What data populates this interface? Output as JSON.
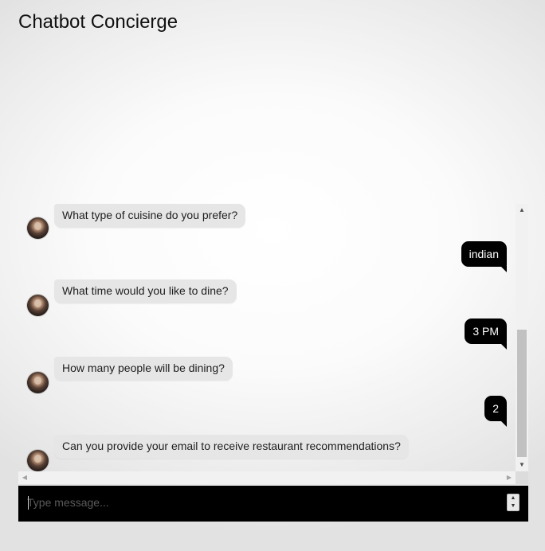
{
  "header": {
    "title": "Chatbot Concierge"
  },
  "chat": {
    "messages": [
      {
        "sender": "bot",
        "text": "What type of cuisine do you prefer?"
      },
      {
        "sender": "user",
        "text": "indian"
      },
      {
        "sender": "bot",
        "text": "What time would you like to dine?"
      },
      {
        "sender": "user",
        "text": "3 PM"
      },
      {
        "sender": "bot",
        "text": "How many people will be dining?"
      },
      {
        "sender": "user",
        "text": "2"
      },
      {
        "sender": "bot",
        "text": "Can you provide your email to receive restaurant recommendations?"
      }
    ]
  },
  "composer": {
    "placeholder": "Type message...",
    "value": ""
  },
  "icons": {
    "scroll_up": "triangle-up-icon",
    "scroll_down": "triangle-down-icon",
    "scroll_left": "triangle-left-icon",
    "scroll_right": "triangle-right-icon",
    "spinner_up": "spinner-up-icon",
    "spinner_down": "spinner-down-icon"
  },
  "colors": {
    "bot_bubble": "#e6e6e6",
    "user_bubble": "#000000",
    "input_bar": "#000000"
  }
}
